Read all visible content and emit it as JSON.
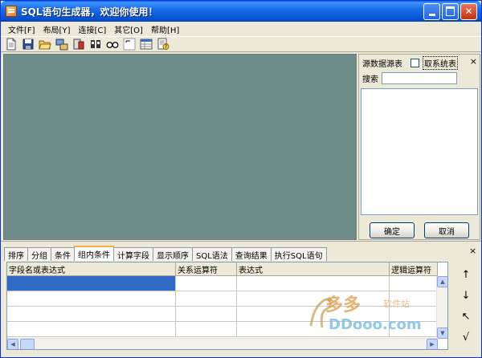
{
  "window": {
    "title": "SQL语句生成器，欢迎你使用！"
  },
  "menu": [
    {
      "label": "文件[F]"
    },
    {
      "label": "布局[Y]"
    },
    {
      "label": "连接[C]"
    },
    {
      "label": "其它[O]"
    },
    {
      "label": "帮助[H]"
    }
  ],
  "toolbar": {
    "icons": [
      "new-file-icon",
      "save-icon",
      "open-folder-icon",
      "connect-icon",
      "database-icon",
      "split-icon",
      "find-icon",
      "text-icon",
      "table-icon",
      "help-icon"
    ]
  },
  "right_panel": {
    "title": "源数据源表",
    "system_table_label": "取系统表",
    "system_table_checked": false,
    "search_label": "搜索",
    "search_value": "",
    "ok_label": "确定",
    "cancel_label": "取消",
    "close_glyph": "×"
  },
  "bottom": {
    "close_glyph": "×",
    "tabs": [
      {
        "label": "排序",
        "active": false
      },
      {
        "label": "分组",
        "active": false
      },
      {
        "label": "条件",
        "active": false
      },
      {
        "label": "组内条件",
        "active": true
      },
      {
        "label": "计算字段",
        "active": false
      },
      {
        "label": "显示顺序",
        "active": false
      },
      {
        "label": "SQL语法",
        "active": false
      },
      {
        "label": "查询结果",
        "active": false
      },
      {
        "label": "执行SQL语句",
        "active": false
      }
    ],
    "grid": {
      "columns": [
        "字段名或表达式",
        "关系运算符",
        "表达式",
        "逻辑运算符"
      ]
    },
    "side_icons": [
      "↑",
      "↓",
      "↖",
      "√"
    ]
  },
  "watermark": {
    "chinese": "多多",
    "software": "软件站",
    "domain": "DDooo.com"
  }
}
